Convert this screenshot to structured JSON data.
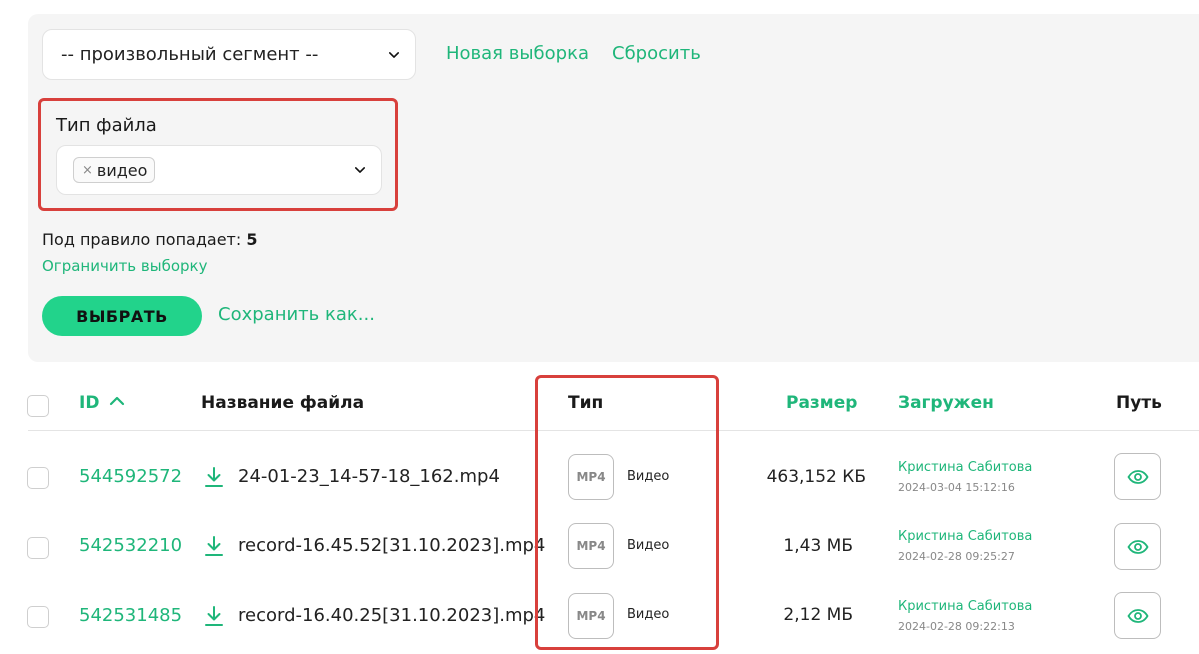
{
  "segment": {
    "value": "-- произвольный сегмент --"
  },
  "actions": {
    "new_sample": "Новая выборка",
    "reset": "Сбросить"
  },
  "filetype": {
    "label": "Тип файла",
    "tag": "видео",
    "tag_remove": "×"
  },
  "rule": {
    "prefix": "Под правило попадает:",
    "count": "5",
    "limit_link": "Ограничить выборку"
  },
  "buttons": {
    "select": "ВЫБРАТЬ",
    "save_as": "Сохранить как..."
  },
  "table": {
    "headers": {
      "id": "ID",
      "name": "Название файла",
      "type": "Тип",
      "size": "Размер",
      "uploaded": "Загружен",
      "path": "Путь"
    },
    "rows": [
      {
        "id": "544592572",
        "name": "24-01-23_14-57-18_162.mp4",
        "badge": "MP4",
        "type": "Видео",
        "size": "463,152 КБ",
        "uploader": "Кристина Сабитова",
        "date": "2024-03-04 15:12:16"
      },
      {
        "id": "542532210",
        "name": "record-16.45.52[31.10.2023].mp4",
        "badge": "MP4",
        "type": "Видео",
        "size": "1,43 МБ",
        "uploader": "Кристина Сабитова",
        "date": "2024-02-28 09:25:27"
      },
      {
        "id": "542531485",
        "name": "record-16.40.25[31.10.2023].mp4",
        "badge": "MP4",
        "type": "Видео",
        "size": "2,12 МБ",
        "uploader": "Кристина Сабитова",
        "date": "2024-02-28 09:22:13"
      }
    ]
  },
  "colors": {
    "accent": "#1fb67a",
    "button": "#22d38b",
    "highlight": "#d8403c"
  },
  "icons": {
    "sort": "chevron-up-icon",
    "download": "download-icon",
    "view": "eye-icon",
    "dropdown": "chevron-down-icon"
  }
}
